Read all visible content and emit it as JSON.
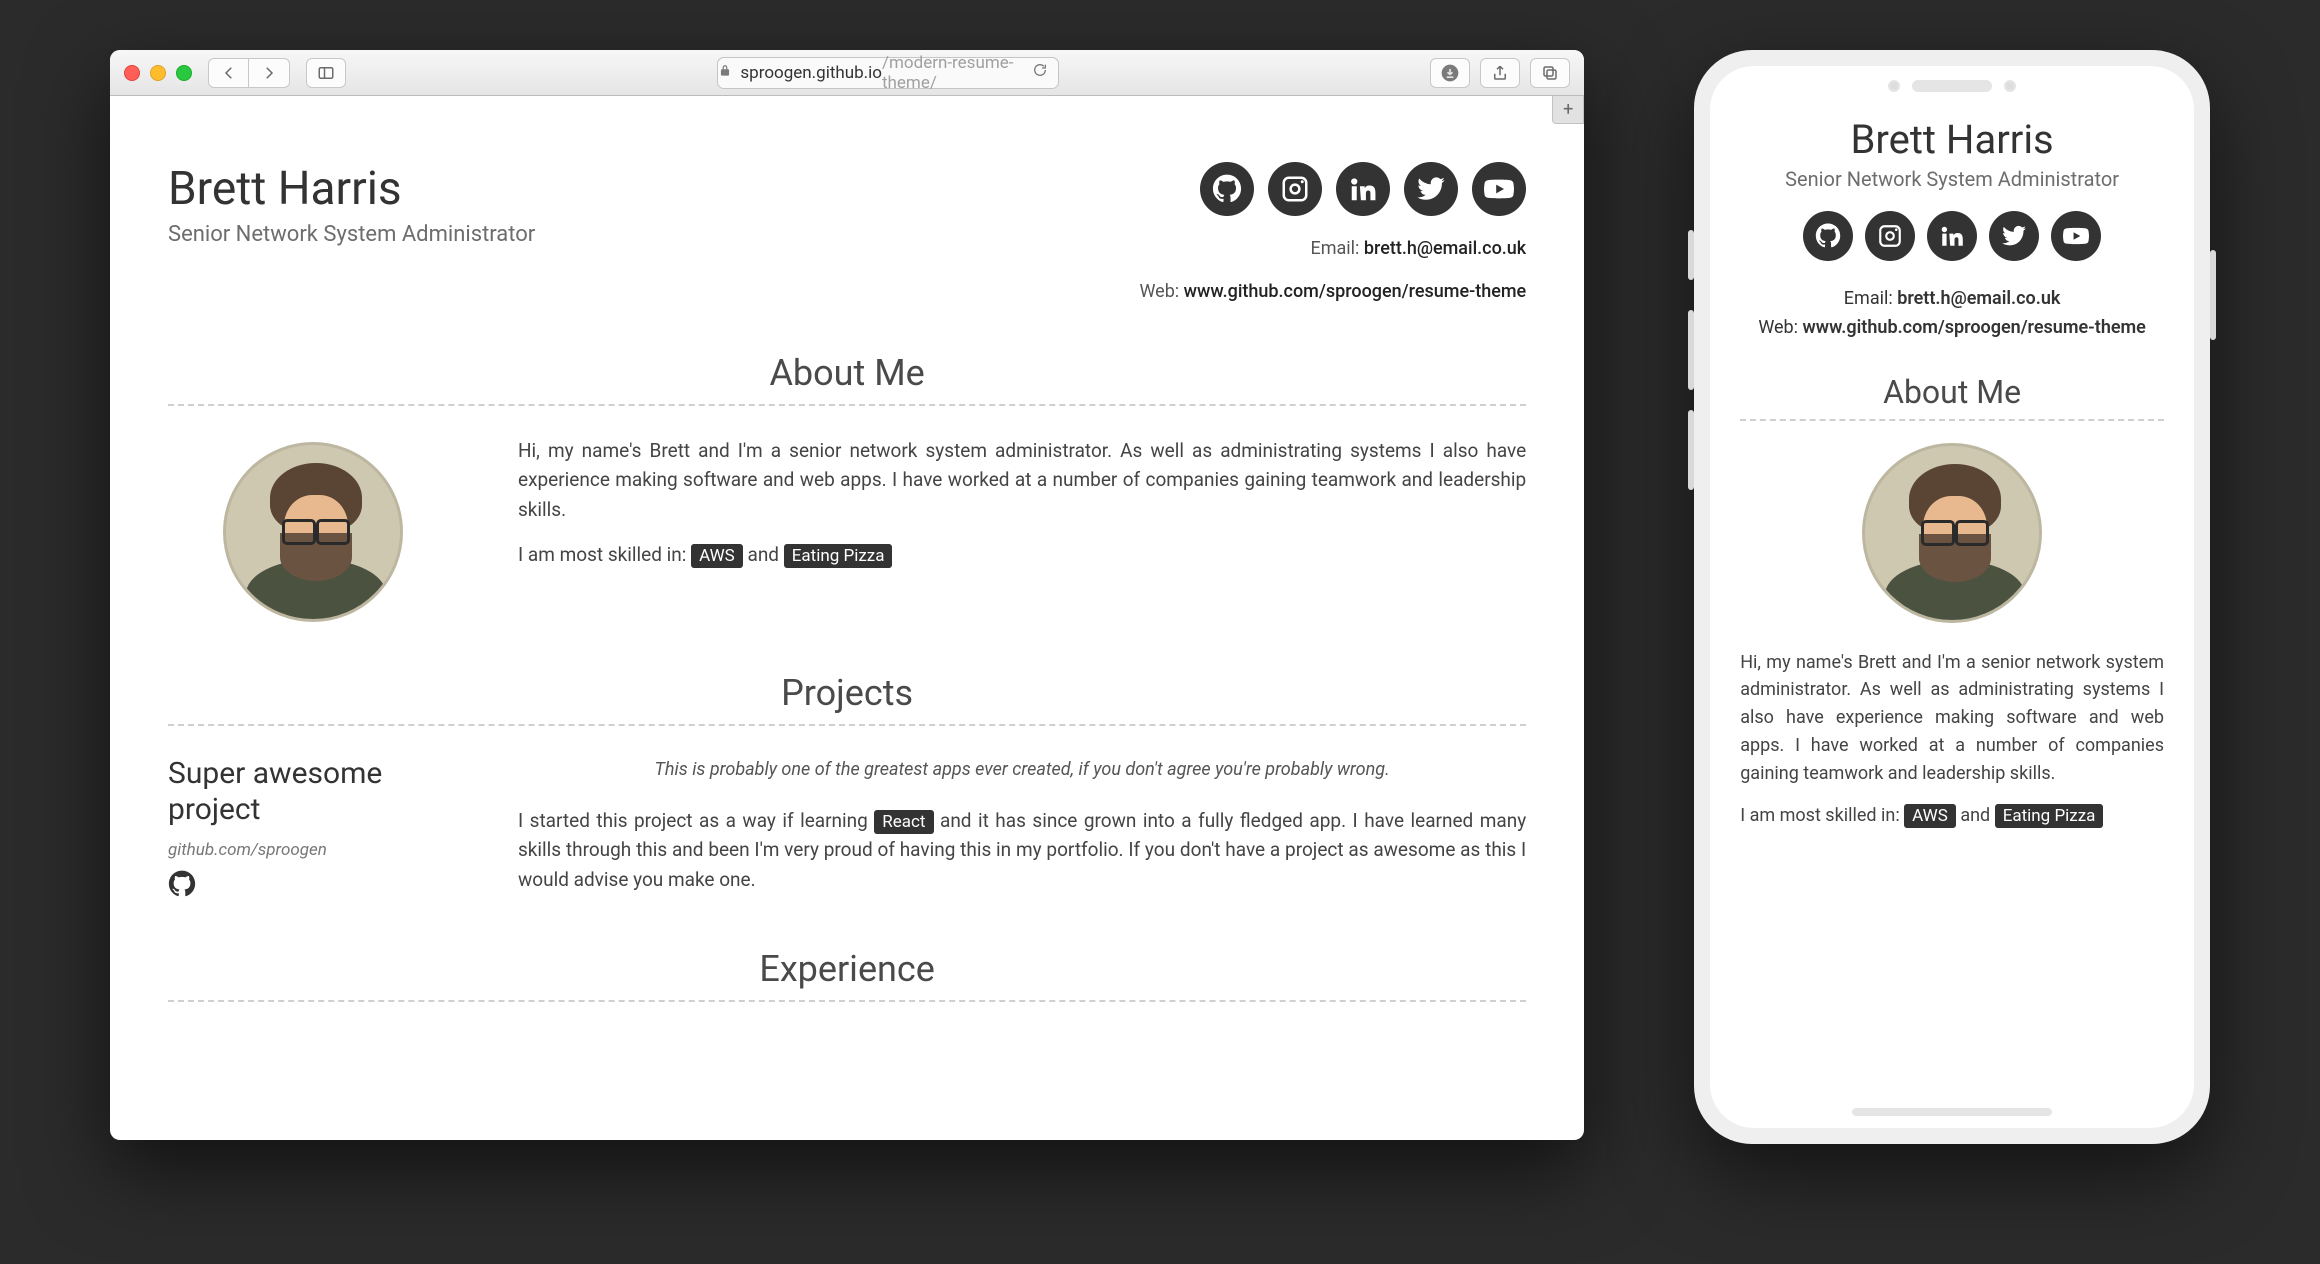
{
  "browser": {
    "url_host": "sproogen.github.io",
    "url_path": "/modern-resume-theme/"
  },
  "header": {
    "name": "Brett Harris",
    "role": "Senior Network System Administrator",
    "email_label": "Email:",
    "email_value": "brett.h@email.co.uk",
    "web_label": "Web:",
    "web_value": "www.github.com/sproogen/resume-theme"
  },
  "socials": {
    "github": "github-icon",
    "instagram": "instagram-icon",
    "linkedin": "linkedin-icon",
    "twitter": "twitter-icon",
    "youtube": "youtube-icon"
  },
  "sections": {
    "about": "About Me",
    "projects": "Projects",
    "experience": "Experience"
  },
  "about": {
    "p1": "Hi, my name's Brett and I'm a senior network system administrator. As well as administrating systems I also have experience making software and web apps. I have worked at a number of companies gaining teamwork and leadership skills.",
    "skills_lead": "I am most skilled in:",
    "skill1": "AWS",
    "skills_join": "and",
    "skill2": "Eating Pizza"
  },
  "project": {
    "title": "Super awesome project",
    "link": "github.com/sproogen",
    "quote": "This is probably one of the greatest apps ever created, if you don't agree you're probably wrong.",
    "desc_a": "I started this project as a way if learning ",
    "chip": "React",
    "desc_b": " and it has since grown into a fully fledged app. I have learned many skills through this and been I'm very proud of having this in my portfolio. If you don't have a project as awesome as this I would advise you make one."
  }
}
